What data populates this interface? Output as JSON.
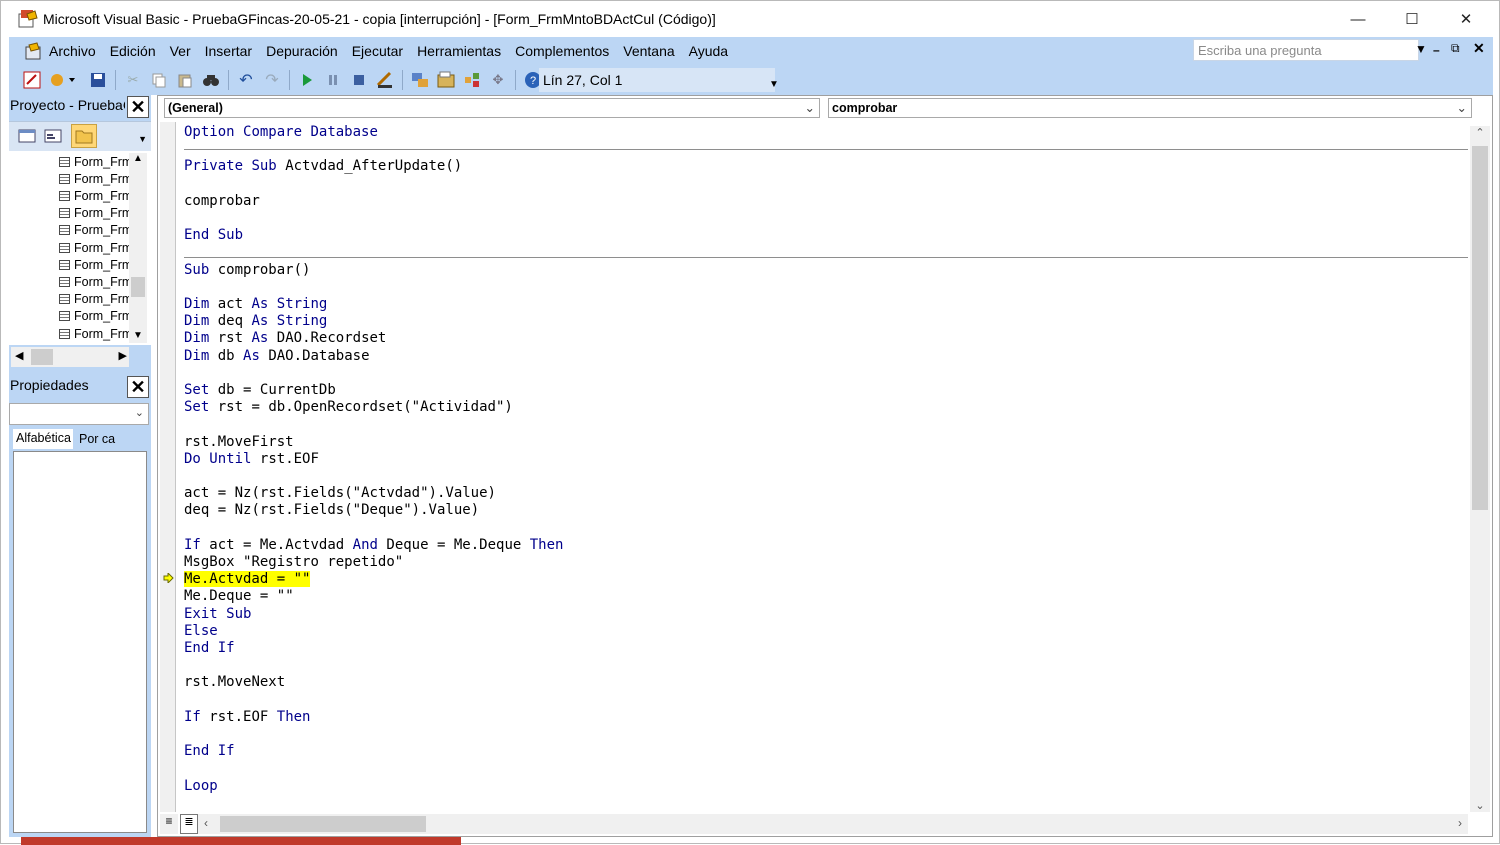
{
  "window": {
    "title": "Microsoft Visual Basic - PruebaGFincas-20-05-21 - copia [interrupción] - [Form_FrmMntoBDActCul (Código)]",
    "controls": {
      "minimize": "—",
      "maximize": "☐",
      "close": "✕"
    }
  },
  "menu": {
    "items": [
      {
        "label": "Archivo"
      },
      {
        "label": "Edición"
      },
      {
        "label": "Ver"
      },
      {
        "label": "Insertar"
      },
      {
        "label": "Depuración"
      },
      {
        "label": "Ejecutar"
      },
      {
        "label": "Herramientas"
      },
      {
        "label": "Complementos"
      },
      {
        "label": "Ventana"
      },
      {
        "label": "Ayuda"
      }
    ],
    "ask_placeholder": "Escriba una pregunta"
  },
  "toolbar": {
    "position": "Lín 27, Col 1"
  },
  "project": {
    "header": "Proyecto - PruebaG",
    "items": [
      "Form_Frm",
      "Form_Frm",
      "Form_Frm",
      "Form_Frm",
      "Form_Frm",
      "Form_Frm",
      "Form_Frm",
      "Form_Frm",
      "Form_Frm",
      "Form_Frm",
      "Form_Frm"
    ]
  },
  "properties": {
    "header": "Propiedades",
    "tab_alpha": "Alfabética",
    "tab_cat": "Por ca"
  },
  "editor": {
    "object_combo": "(General)",
    "proc_combo": "comprobar",
    "lines": [
      "Option Compare Database",
      "",
      "Private Sub Actvdad_AfterUpdate()",
      "",
      "comprobar",
      "",
      "End Sub",
      "",
      "Sub comprobar()",
      "",
      "Dim act As String",
      "Dim deq As String",
      "Dim rst As DAO.Recordset",
      "Dim db As DAO.Database",
      "",
      "Set db = CurrentDb",
      "Set rst = db.OpenRecordset(\"Actividad\")",
      "",
      "rst.MoveFirst",
      "Do Until rst.EOF",
      "",
      "act = Nz(rst.Fields(\"Actvdad\").Value)",
      "deq = Nz(rst.Fields(\"Deque\").Value)",
      "",
      "If act = Me.Actvdad And Deque = Me.Deque Then",
      "MsgBox \"Registro repetido\"",
      "Me.Actvdad = \"\"",
      "Me.Deque = \"\"",
      "Exit Sub",
      "Else",
      "End If",
      "",
      "rst.MoveNext",
      "",
      "If rst.EOF Then",
      "",
      "End If",
      "",
      "Loop"
    ]
  }
}
